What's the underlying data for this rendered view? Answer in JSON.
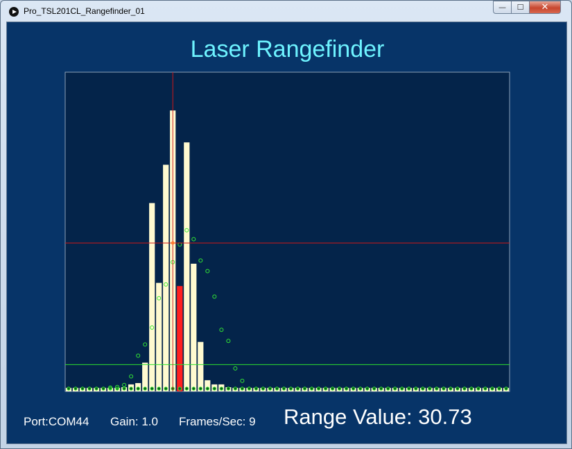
{
  "window": {
    "title": "Pro_TSL201CL_Rangefinder_01",
    "minimize_glyph": "—",
    "maximize_glyph": "☐",
    "close_glyph": "✕"
  },
  "app": {
    "title": "Laser Rangefinder"
  },
  "status": {
    "port": "Port:COM44",
    "gain": "Gain: 1.0",
    "fps": "Frames/Sec: 9",
    "range": "Range Value: 30.73"
  },
  "colors": {
    "background": "#073468",
    "plot_bg": "#04244a",
    "title": "#6ef3ff",
    "bar": "#fffad0",
    "marker_bar": "#ff2020",
    "threshold_line": "#2ee02e",
    "crosshair": "#d01818",
    "fit_point": "#33e833"
  },
  "chart_data": {
    "type": "bar",
    "pixel_count": 64,
    "ylim": [
      0,
      1
    ],
    "values": [
      0.011,
      0.011,
      0.011,
      0.011,
      0.011,
      0.011,
      0.011,
      0.011,
      0.013,
      0.022,
      0.026,
      0.09,
      0.59,
      0.34,
      0.71,
      0.88,
      0.33,
      0.78,
      0.4,
      0.155,
      0.035,
      0.022,
      0.022,
      0.013,
      0.011,
      0.011,
      0.011,
      0.011,
      0.011,
      0.011,
      0.011,
      0.011,
      0.011,
      0.011,
      0.011,
      0.011,
      0.011,
      0.011,
      0.011,
      0.011,
      0.011,
      0.011,
      0.011,
      0.011,
      0.011,
      0.011,
      0.011,
      0.011,
      0.011,
      0.011,
      0.011,
      0.011,
      0.011,
      0.011,
      0.011,
      0.011,
      0.011,
      0.011,
      0.011,
      0.011,
      0.011,
      0.011,
      0.011,
      0.011
    ],
    "highlight_index": 16,
    "fit_points": [
      {
        "x": 6.5,
        "y": 0.012
      },
      {
        "x": 7.5,
        "y": 0.014
      },
      {
        "x": 8.5,
        "y": 0.02
      },
      {
        "x": 9.5,
        "y": 0.047
      },
      {
        "x": 10.5,
        "y": 0.112
      },
      {
        "x": 11.5,
        "y": 0.147
      },
      {
        "x": 12.5,
        "y": 0.2
      },
      {
        "x": 13.5,
        "y": 0.292
      },
      {
        "x": 14.5,
        "y": 0.335
      },
      {
        "x": 15.5,
        "y": 0.405
      },
      {
        "x": 16.5,
        "y": 0.46
      },
      {
        "x": 17.5,
        "y": 0.505
      },
      {
        "x": 18.5,
        "y": 0.477
      },
      {
        "x": 19.5,
        "y": 0.41
      },
      {
        "x": 20.5,
        "y": 0.377
      },
      {
        "x": 21.5,
        "y": 0.297
      },
      {
        "x": 22.5,
        "y": 0.193
      },
      {
        "x": 23.5,
        "y": 0.158
      },
      {
        "x": 24.5,
        "y": 0.072
      },
      {
        "x": 25.5,
        "y": 0.033
      }
    ],
    "peak_position": 15.5,
    "peak_level": 0.465,
    "threshold_level": 0.084,
    "grid": false
  }
}
